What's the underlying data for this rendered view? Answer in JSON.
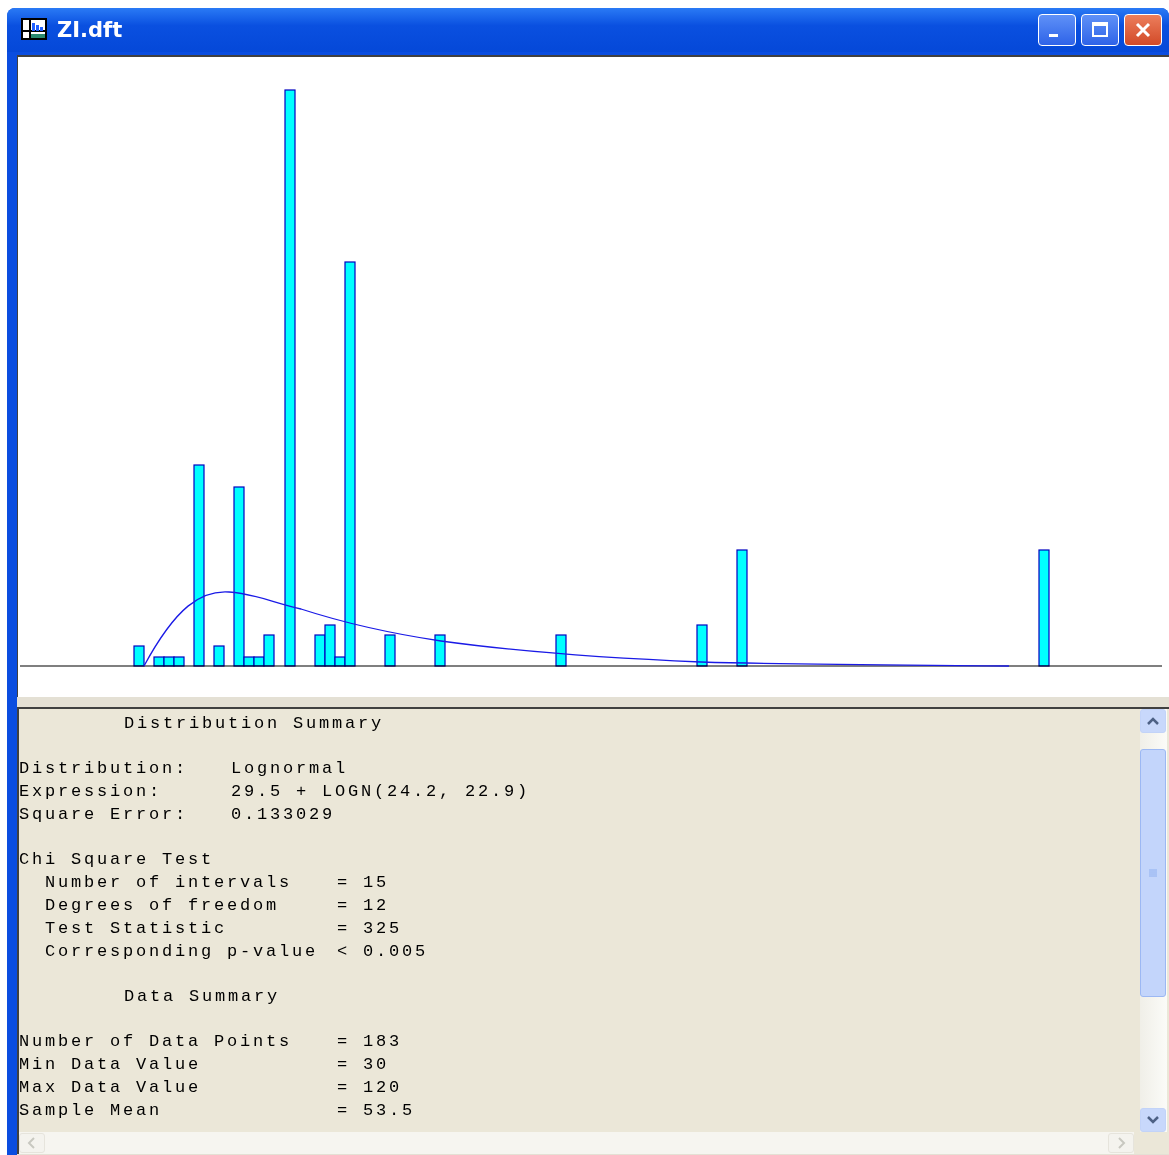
{
  "window": {
    "title": "ZI.dft"
  },
  "summary": {
    "heading": "Distribution Summary",
    "fields": [
      {
        "label": "Distribution:",
        "value": "Lognormal"
      },
      {
        "label": "Expression:",
        "value": "29.5 + LOGN(24.2, 22.9)"
      },
      {
        "label": "Square Error:",
        "value": "0.133029"
      }
    ]
  },
  "chi_square": {
    "title": "Chi Square Test",
    "rows": [
      {
        "label": "Number of intervals",
        "relation": "=",
        "value": "15"
      },
      {
        "label": "Degrees of freedom",
        "relation": "=",
        "value": "12"
      },
      {
        "label": "Test Statistic",
        "relation": "=",
        "value": "325"
      },
      {
        "label": "Corresponding p-value",
        "relation": "<",
        "value": "0.005"
      }
    ]
  },
  "data_summary": {
    "heading": "Data Summary",
    "rows": [
      {
        "label": "Number of Data Points",
        "relation": "=",
        "value": "183"
      },
      {
        "label": "Min Data Value",
        "relation": "=",
        "value": "30"
      },
      {
        "label": "Max Data Value",
        "relation": "=",
        "value": "120"
      },
      {
        "label": "Sample Mean",
        "relation": "=",
        "value": "53.5"
      }
    ]
  }
}
